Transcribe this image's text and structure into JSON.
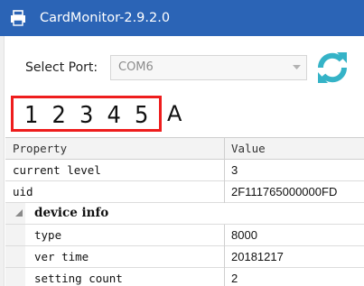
{
  "window": {
    "title": "CardMonitor-2.9.2.0",
    "icon": "printer-icon",
    "titlebar_color": "#2b64b6"
  },
  "port": {
    "label": "Select Port:",
    "value": "COM6"
  },
  "refresh": {
    "icon": "refresh-icon",
    "color": "#35b3c7"
  },
  "display": {
    "digits": "1 2 3 4 5",
    "suffix": "A",
    "border_color": "#ee1d1d"
  },
  "grid": {
    "headers": {
      "property": "Property",
      "value": "Value"
    },
    "rows": [
      {
        "property": "current level",
        "value": "3"
      },
      {
        "property": "uid",
        "value": "2F111765000000FD"
      }
    ],
    "category": {
      "name": "device info",
      "expanded": true,
      "rows": [
        {
          "property": "type",
          "value": "8000"
        },
        {
          "property": "ver time",
          "value": "20181217"
        },
        {
          "property": "setting count",
          "value": "2"
        }
      ]
    }
  }
}
